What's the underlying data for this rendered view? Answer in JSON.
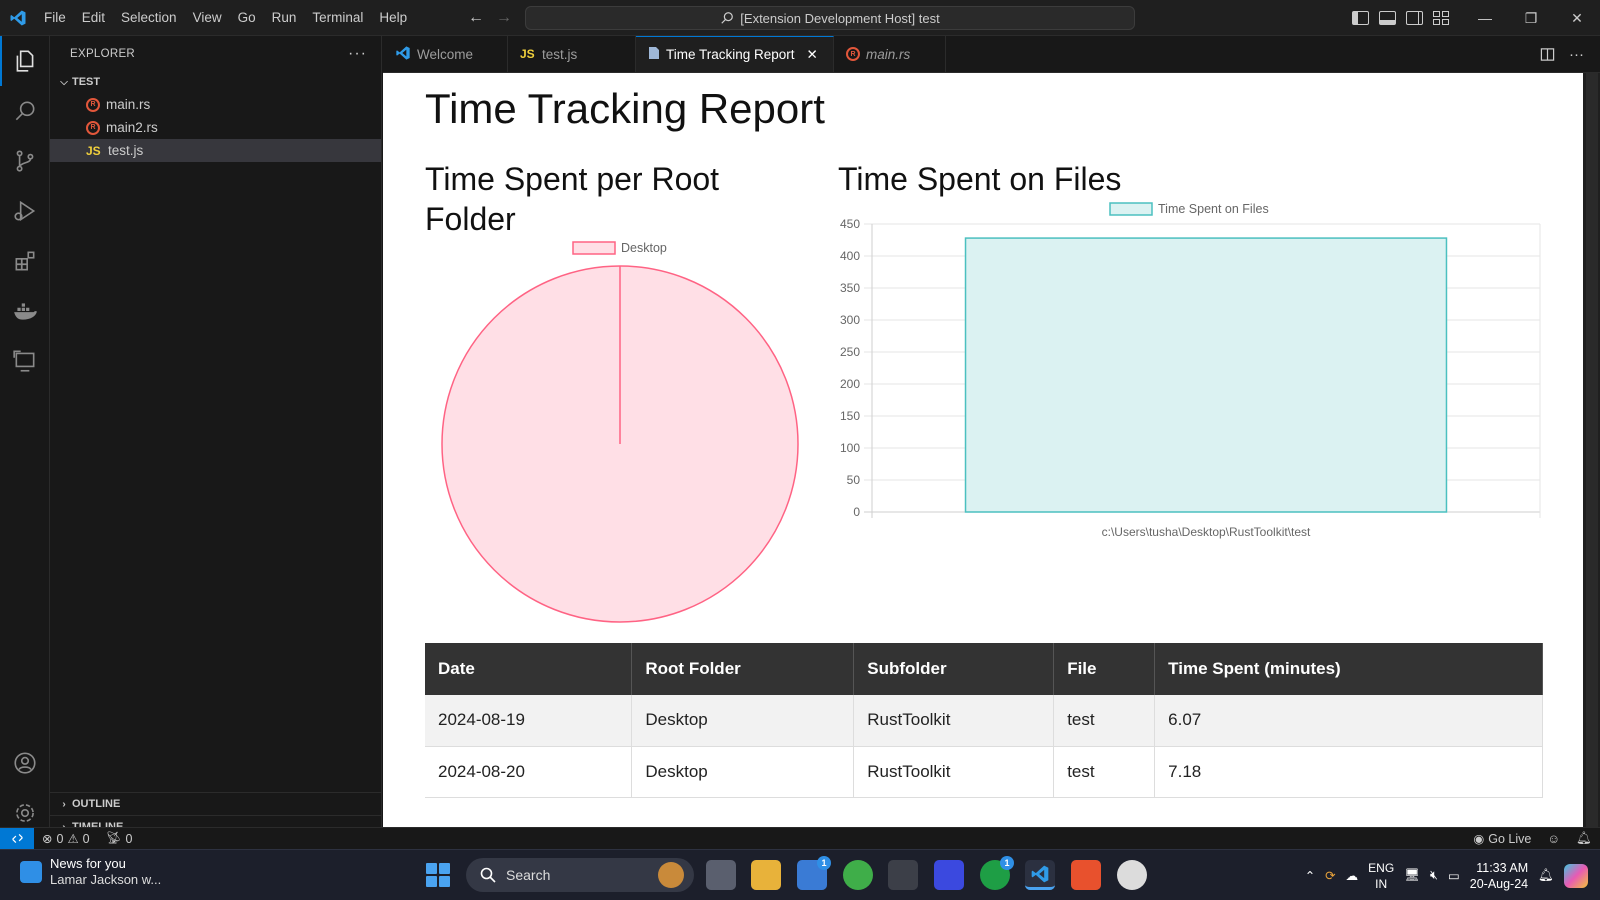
{
  "menu": [
    "File",
    "Edit",
    "Selection",
    "View",
    "Go",
    "Run",
    "Terminal",
    "Help"
  ],
  "command_center": "[Extension Development Host] test",
  "sidebar": {
    "title": "EXPLORER",
    "folder": "TEST",
    "files": [
      {
        "name": "main.rs",
        "type": "rust"
      },
      {
        "name": "main2.rs",
        "type": "rust"
      },
      {
        "name": "test.js",
        "type": "js"
      }
    ],
    "outline": "OUTLINE",
    "timeline": "TIMELINE"
  },
  "tabs": [
    {
      "label": "Welcome",
      "icon": "vscode-icon"
    },
    {
      "label": "test.js",
      "icon": "js-icon"
    },
    {
      "label": "Time Tracking Report",
      "icon": "preview-icon",
      "active": true
    },
    {
      "label": "main.rs",
      "icon": "rust-icon",
      "italic": true
    }
  ],
  "report": {
    "title": "Time Tracking Report",
    "pie_heading": "Time Spent per Root Folder",
    "bar_heading": "Time Spent on Files"
  },
  "chart_data": [
    {
      "type": "pie",
      "categories": [
        "Desktop"
      ],
      "values": [
        100
      ],
      "legend": [
        "Desktop"
      ],
      "colors": {
        "fill": "#ffdfe6",
        "stroke": "#ff6384"
      }
    },
    {
      "type": "bar",
      "categories": [
        "c:\\Users\\tusha\\Desktop\\RustToolkit\\test"
      ],
      "series": [
        {
          "name": "Time Spent on Files",
          "values": [
            428
          ]
        }
      ],
      "ylim": [
        0,
        450
      ],
      "yticks": [
        0,
        50,
        100,
        150,
        200,
        250,
        300,
        350,
        400,
        450
      ],
      "grid": true,
      "legend_position": "top",
      "colors": {
        "fill": "#dbf2f2",
        "stroke": "#4bc0c0"
      }
    }
  ],
  "table": {
    "headers": [
      "Date",
      "Root Folder",
      "Subfolder",
      "File",
      "Time Spent (minutes)"
    ],
    "rows": [
      [
        "2024-08-19",
        "Desktop",
        "RustToolkit",
        "test",
        "6.07"
      ],
      [
        "2024-08-20",
        "Desktop",
        "RustToolkit",
        "test",
        "7.18"
      ]
    ]
  },
  "status": {
    "errors": "0",
    "warnings": "0",
    "ports": "0",
    "go_live": "Go Live"
  },
  "taskbar": {
    "news_title": "News for you",
    "news_sub": "Lamar Jackson w...",
    "search": "Search",
    "badge_store": "1",
    "badge_xbox": "1",
    "lang_top": "ENG",
    "lang_bottom": "IN",
    "time": "11:33 AM",
    "date": "20-Aug-24"
  }
}
